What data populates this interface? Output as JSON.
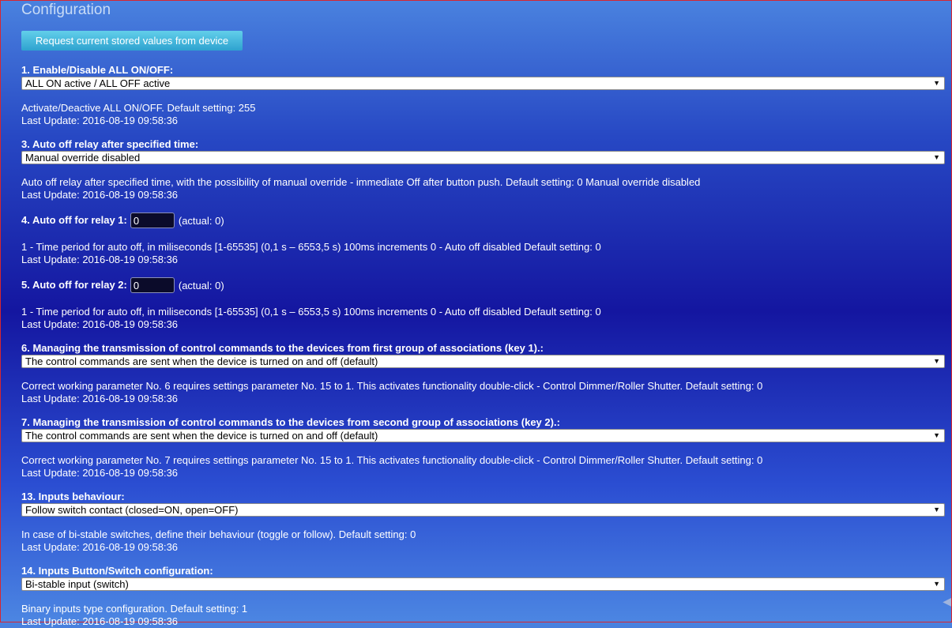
{
  "page": {
    "title": "Configuration"
  },
  "toolbar": {
    "request_label": "Request current stored values from device"
  },
  "params": [
    {
      "label": "1. Enable/Disable ALL ON/OFF:",
      "kind": "select",
      "value": "ALL ON active / ALL OFF active",
      "desc": "Activate/Deactive ALL ON/OFF. Default setting: 255",
      "update": "Last Update: 2016-08-19 09:58:36"
    },
    {
      "label": "3. Auto off relay after specified time:",
      "kind": "select",
      "value": "Manual override disabled",
      "desc": "Auto off relay after specified time, with the possibility of manual override - immediate Off after button push. Default setting: 0 Manual override disabled",
      "update": "Last Update: 2016-08-19 09:58:36"
    },
    {
      "label": "4. Auto off for relay 1:",
      "kind": "number",
      "value": "0",
      "actual": "(actual: 0)",
      "desc": "1 - Time period for auto off, in miliseconds [1-65535] (0,1 s – 6553,5 s) 100ms increments 0 - Auto off disabled Default setting: 0",
      "update": "Last Update: 2016-08-19 09:58:36"
    },
    {
      "label": "5. Auto off for relay 2:",
      "kind": "number",
      "value": "0",
      "actual": "(actual: 0)",
      "desc": "1 - Time period for auto off, in miliseconds [1-65535] (0,1 s – 6553,5 s) 100ms increments 0 - Auto off disabled Default setting: 0",
      "update": "Last Update: 2016-08-19 09:58:36"
    },
    {
      "label": "6. Managing the transmission of control commands to the devices from first group of associations (key 1).:",
      "kind": "select",
      "value": "The control commands are sent when the device is turned on and off (default)",
      "desc": "Correct working parameter No. 6 requires settings parameter No. 15 to 1. This activates functionality double-click - Control Dimmer/Roller Shutter. Default setting: 0",
      "update": "Last Update: 2016-08-19 09:58:36"
    },
    {
      "label": "7. Managing the transmission of control commands to the devices from second group of associations (key 2).:",
      "kind": "select",
      "value": "The control commands are sent when the device is turned on and off (default)",
      "desc": "Correct working parameter No. 7 requires settings parameter No. 15 to 1. This activates functionality double-click - Control Dimmer/Roller Shutter. Default setting: 0",
      "update": "Last Update: 2016-08-19 09:58:36"
    },
    {
      "label": "13. Inputs behaviour:",
      "kind": "select",
      "value": "Follow switch contact (closed=ON, open=OFF)",
      "desc": "In case of bi-stable switches, define their behaviour (toggle or follow). Default setting: 0",
      "update": "Last Update: 2016-08-19 09:58:36"
    },
    {
      "label": "14. Inputs Button/Switch configuration:",
      "kind": "select",
      "value": "Bi-stable input (switch)",
      "desc": "Binary inputs type configuration. Default setting: 1",
      "update": "Last Update: 2016-08-19 09:58:36"
    }
  ],
  "icons": {
    "dropdown": "chevron-down-icon"
  },
  "colors": {
    "accent": "#2ea2cf",
    "background_mid": "#1416a0",
    "border": "#d8262f"
  }
}
